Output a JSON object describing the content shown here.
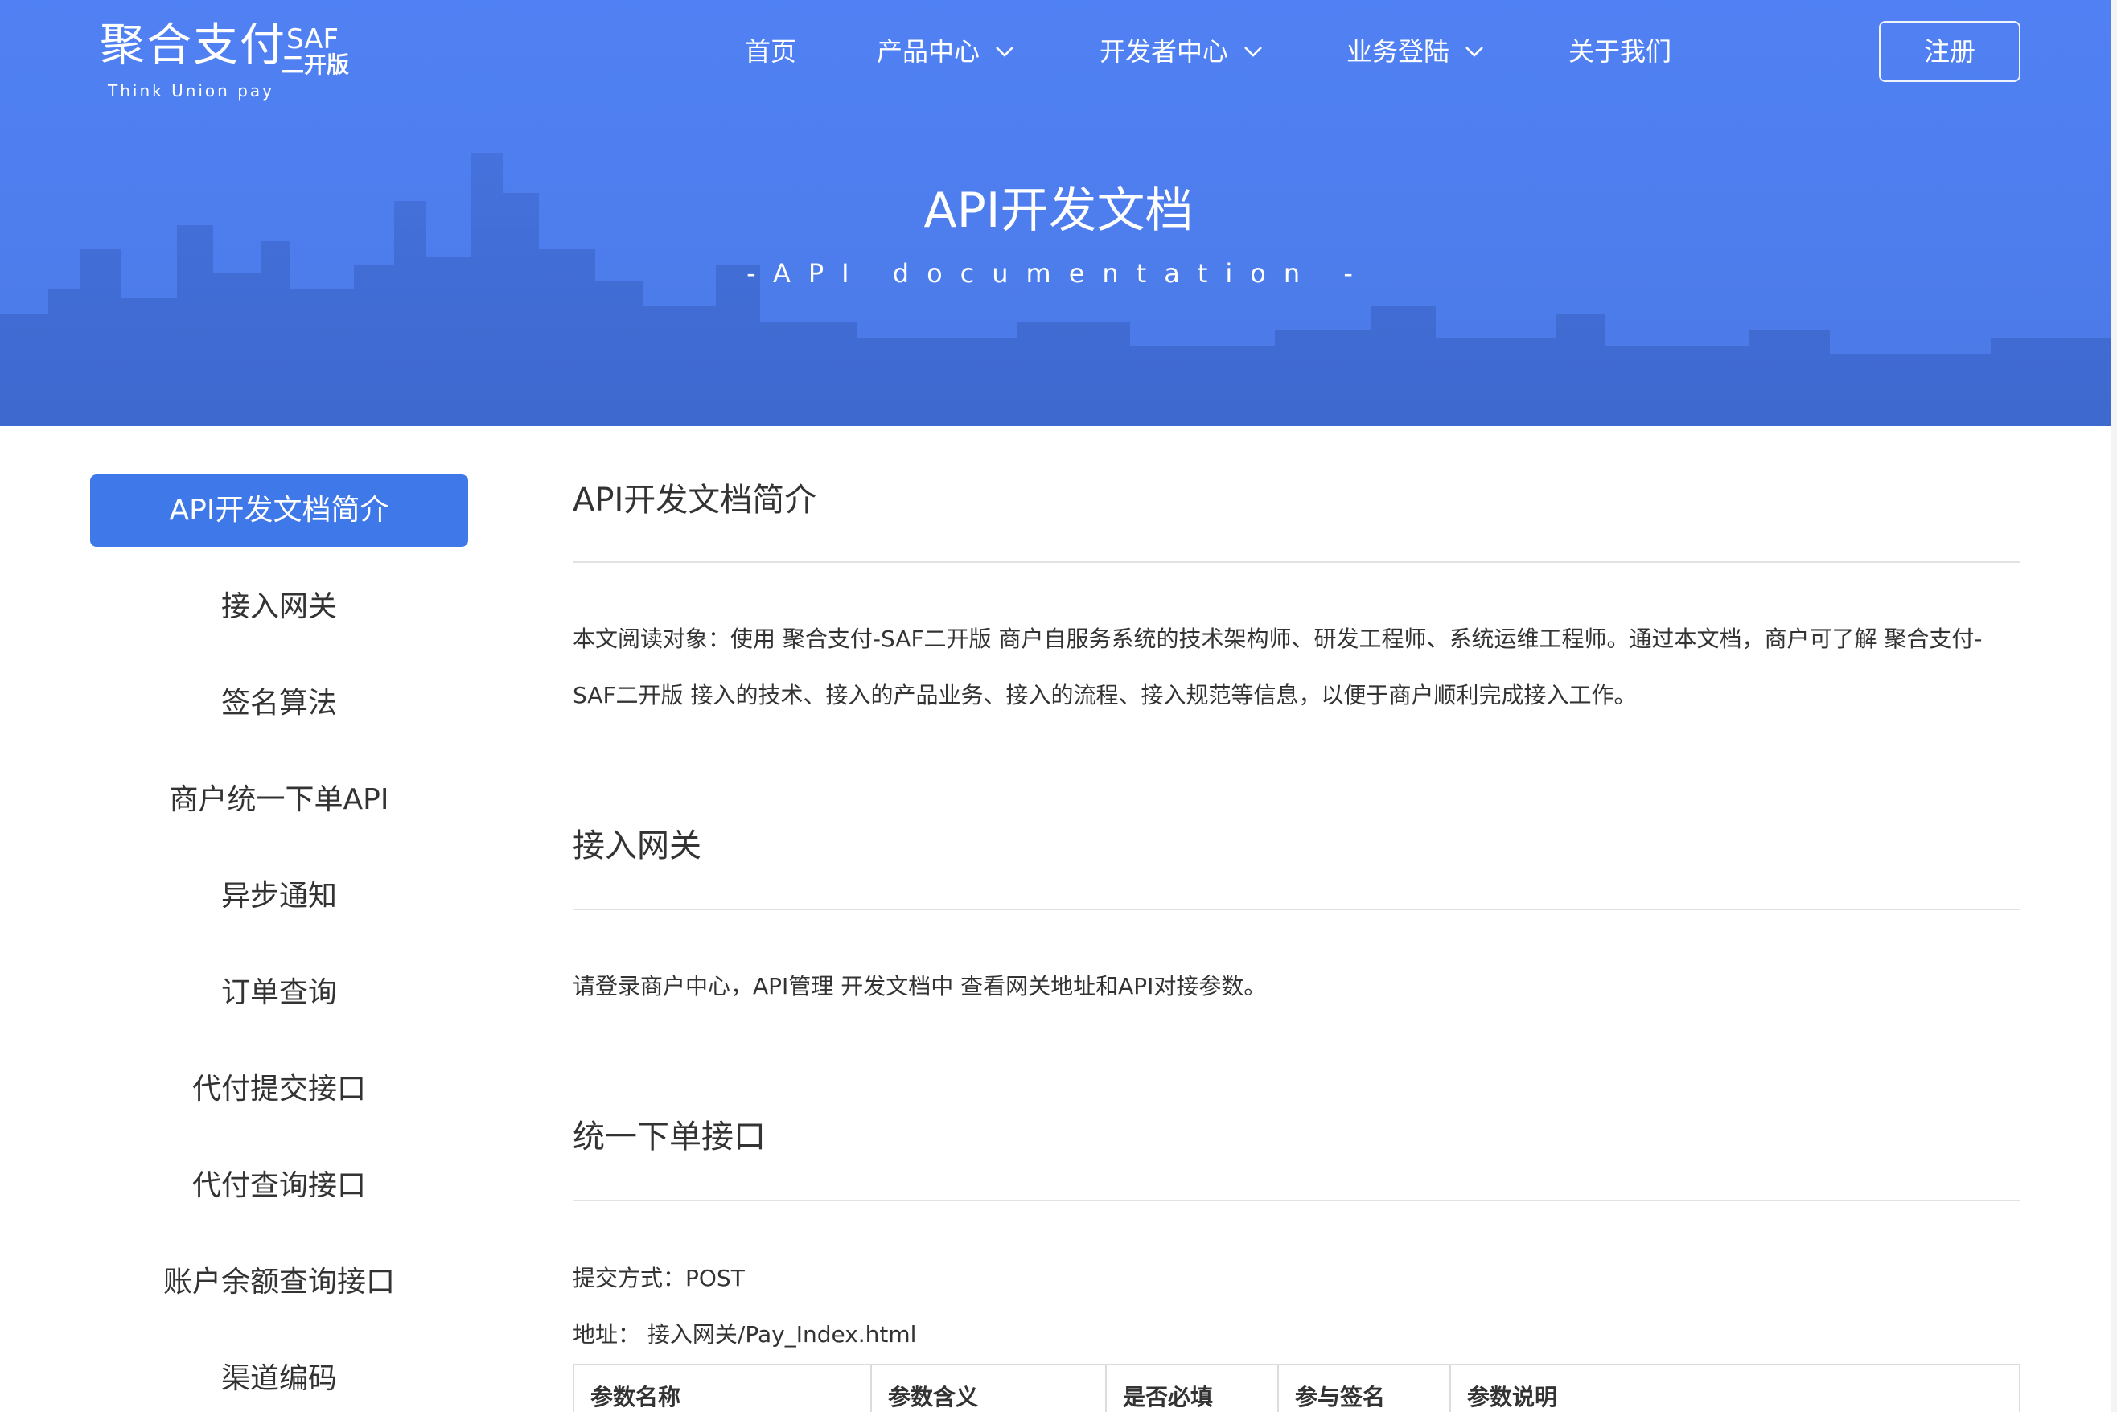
{
  "header": {
    "logo": {
      "cn": "聚合支付",
      "saf": "SAF",
      "edition": "二开版",
      "en": "Think Union pay"
    },
    "nav": [
      {
        "label": "首页",
        "has_dropdown": false
      },
      {
        "label": "产品中心",
        "has_dropdown": true
      },
      {
        "label": "开发者中心",
        "has_dropdown": true
      },
      {
        "label": "业务登陆",
        "has_dropdown": true
      },
      {
        "label": "关于我们",
        "has_dropdown": false
      }
    ],
    "register_label": "注册"
  },
  "hero": {
    "title": "API开发文档",
    "subtitle": "-API documentation -"
  },
  "sidebar": {
    "items": [
      {
        "label": "API开发文档简介",
        "active": true
      },
      {
        "label": "接入网关",
        "active": false
      },
      {
        "label": "签名算法",
        "active": false
      },
      {
        "label": "商户统一下单API",
        "active": false
      },
      {
        "label": "异步通知",
        "active": false
      },
      {
        "label": "订单查询",
        "active": false
      },
      {
        "label": "代付提交接口",
        "active": false
      },
      {
        "label": "代付查询接口",
        "active": false
      },
      {
        "label": "账户余额查询接口",
        "active": false
      },
      {
        "label": "渠道编码",
        "active": false
      }
    ]
  },
  "content": {
    "intro": {
      "title": "API开发文档简介",
      "text": "本文阅读对象：使用 聚合支付-SAF二开版 商户自服务系统的技术架构师、研发工程师、系统运维工程师。通过本文档，商户可了解 聚合支付-SAF二开版 接入的技术、接入的产品业务、接入的流程、接入规范等信息，以便于商户顺利完成接入工作。"
    },
    "gateway": {
      "title": "接入网关",
      "text": "请登录商户中心，API管理 开发文档中 查看网关地址和API对接参数。"
    },
    "order": {
      "title": "统一下单接口",
      "method_line": "提交方式：POST",
      "address_line": "地址： 接入网关/Pay_Index.html",
      "table_headers": [
        "参数名称",
        "参数含义",
        "是否必填",
        "参与签名",
        "参数说明"
      ]
    }
  },
  "colors": {
    "hero_bg": "#4f7ff0",
    "active_item": "#3f78e8",
    "rule": "#e2e2e2"
  }
}
